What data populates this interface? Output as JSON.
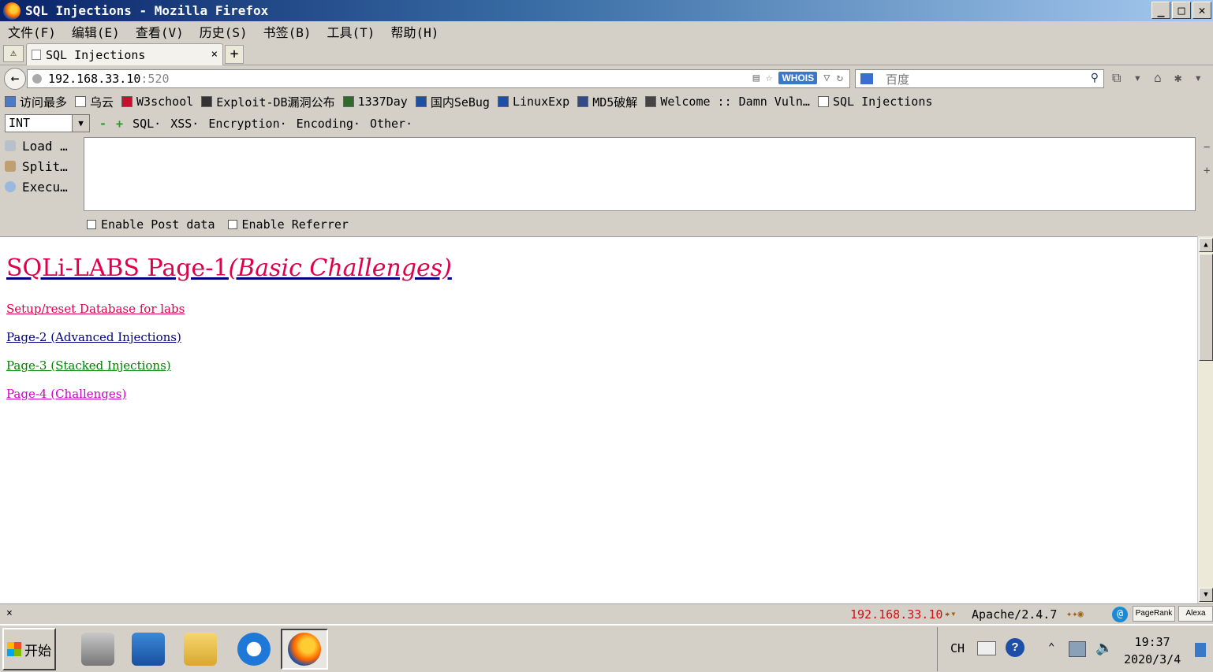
{
  "window": {
    "title": "SQL Injections - Mozilla Firefox",
    "buttons": {
      "minimize": "_",
      "maximize": "□",
      "close": "✕"
    }
  },
  "menubar": [
    "文件(F)",
    "编辑(E)",
    "查看(V)",
    "历史(S)",
    "书签(B)",
    "工具(T)",
    "帮助(H)"
  ],
  "tabs": [
    {
      "label": "SQL Injections",
      "close": "×"
    }
  ],
  "new_tab_label": "+",
  "navbar": {
    "url_host": "192.168.33.10",
    "url_port": ":520",
    "whois_label": "WHOIS",
    "search_placeholder": "百度"
  },
  "bookmarks": [
    {
      "label": "访问最多",
      "icon": "most-visited-icon"
    },
    {
      "label": "乌云",
      "icon": "page-icon"
    },
    {
      "label": "W3school",
      "icon": "w3school-icon"
    },
    {
      "label": "Exploit-DB漏洞公布",
      "icon": "exploit-db-icon"
    },
    {
      "label": "1337Day",
      "icon": "1337day-icon"
    },
    {
      "label": "国内SeBug",
      "icon": "sebug-icon"
    },
    {
      "label": "LinuxExp",
      "icon": "linuxexp-icon"
    },
    {
      "label": "MD5破解",
      "icon": "md5-icon"
    },
    {
      "label": "Welcome :: Damn Vuln…",
      "icon": "dvwa-icon"
    },
    {
      "label": "SQL Injections",
      "icon": "page-icon"
    }
  ],
  "hackbar": {
    "select_value": "INT",
    "menus": [
      "SQL·",
      "XSS·",
      "Encryption·",
      "Encoding·",
      "Other·"
    ],
    "buttons": [
      "Load …",
      "Split…",
      "Execu…"
    ],
    "textarea_value": "",
    "checkboxes": [
      "Enable Post data",
      "Enable Referrer"
    ],
    "side_minus": "−",
    "side_plus": "+"
  },
  "content": {
    "heading_main": "SQLi-LABS Page-1",
    "heading_em": "(Basic Challenges)",
    "links": [
      {
        "label": "Setup/reset Database for labs",
        "color": "#e0004a"
      },
      {
        "label": "Page-2 (Advanced Injections)",
        "color": "#000080"
      },
      {
        "label": "Page-3 (Stacked Injections)",
        "color": "#008000"
      },
      {
        "label": "Page-4 (Challenges)",
        "color": "#cc00cc"
      }
    ]
  },
  "statusbar": {
    "close": "×",
    "ip": "192.168.33.10·",
    "server": "Apache/2.4.7",
    "pagerank": "PageRank",
    "alexa": "Alexa"
  },
  "taskbar": {
    "start_label": "开始",
    "ime": "CH",
    "help": "?",
    "time": "19:37",
    "date": "2020/3/4"
  },
  "colors": {
    "title_gradient_start": "#0a246a",
    "link_heading": "#e0004a",
    "status_ip": "#d01010"
  }
}
